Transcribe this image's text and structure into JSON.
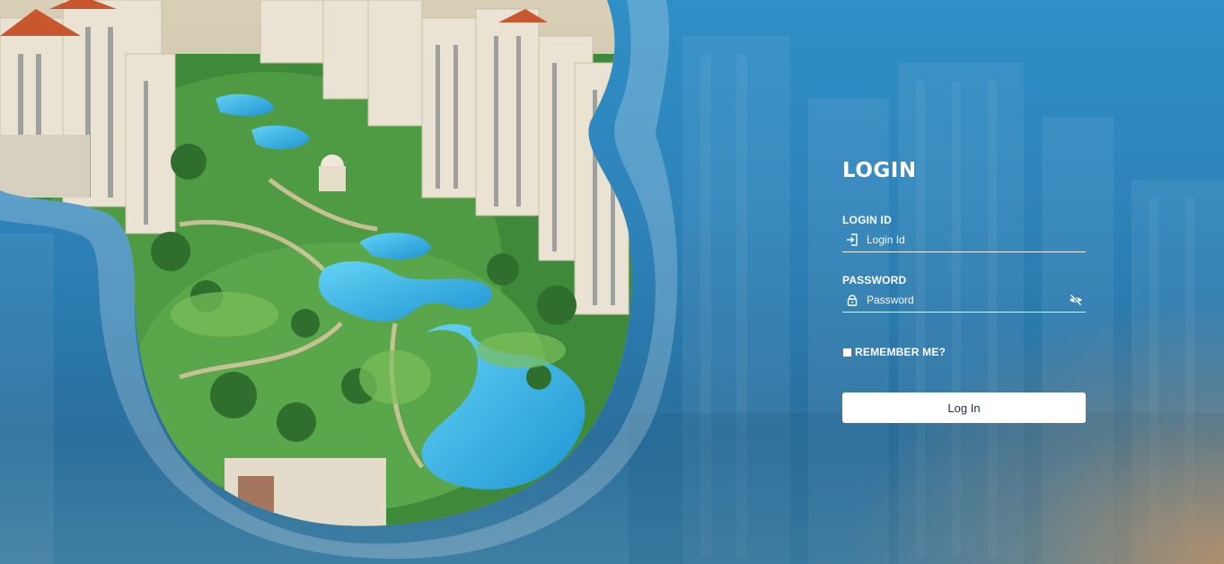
{
  "login": {
    "title": "LOGIN",
    "login_id_label": "LOGIN ID",
    "login_id_placeholder": "Login Id",
    "login_id_value": "",
    "password_label": "PASSWORD",
    "password_placeholder": "Password",
    "password_value": "",
    "remember_label": "REMEMBER ME?",
    "remember_checked": false,
    "submit_label": "Log In"
  },
  "icons": {
    "login_id": "sign-in-icon",
    "password": "lock-icon",
    "toggle_password": "eye-slash-icon"
  },
  "colors": {
    "background": "#2e84bb",
    "text": "#ffffff",
    "button_bg": "#ffffff",
    "button_text": "#1f2d3a"
  }
}
